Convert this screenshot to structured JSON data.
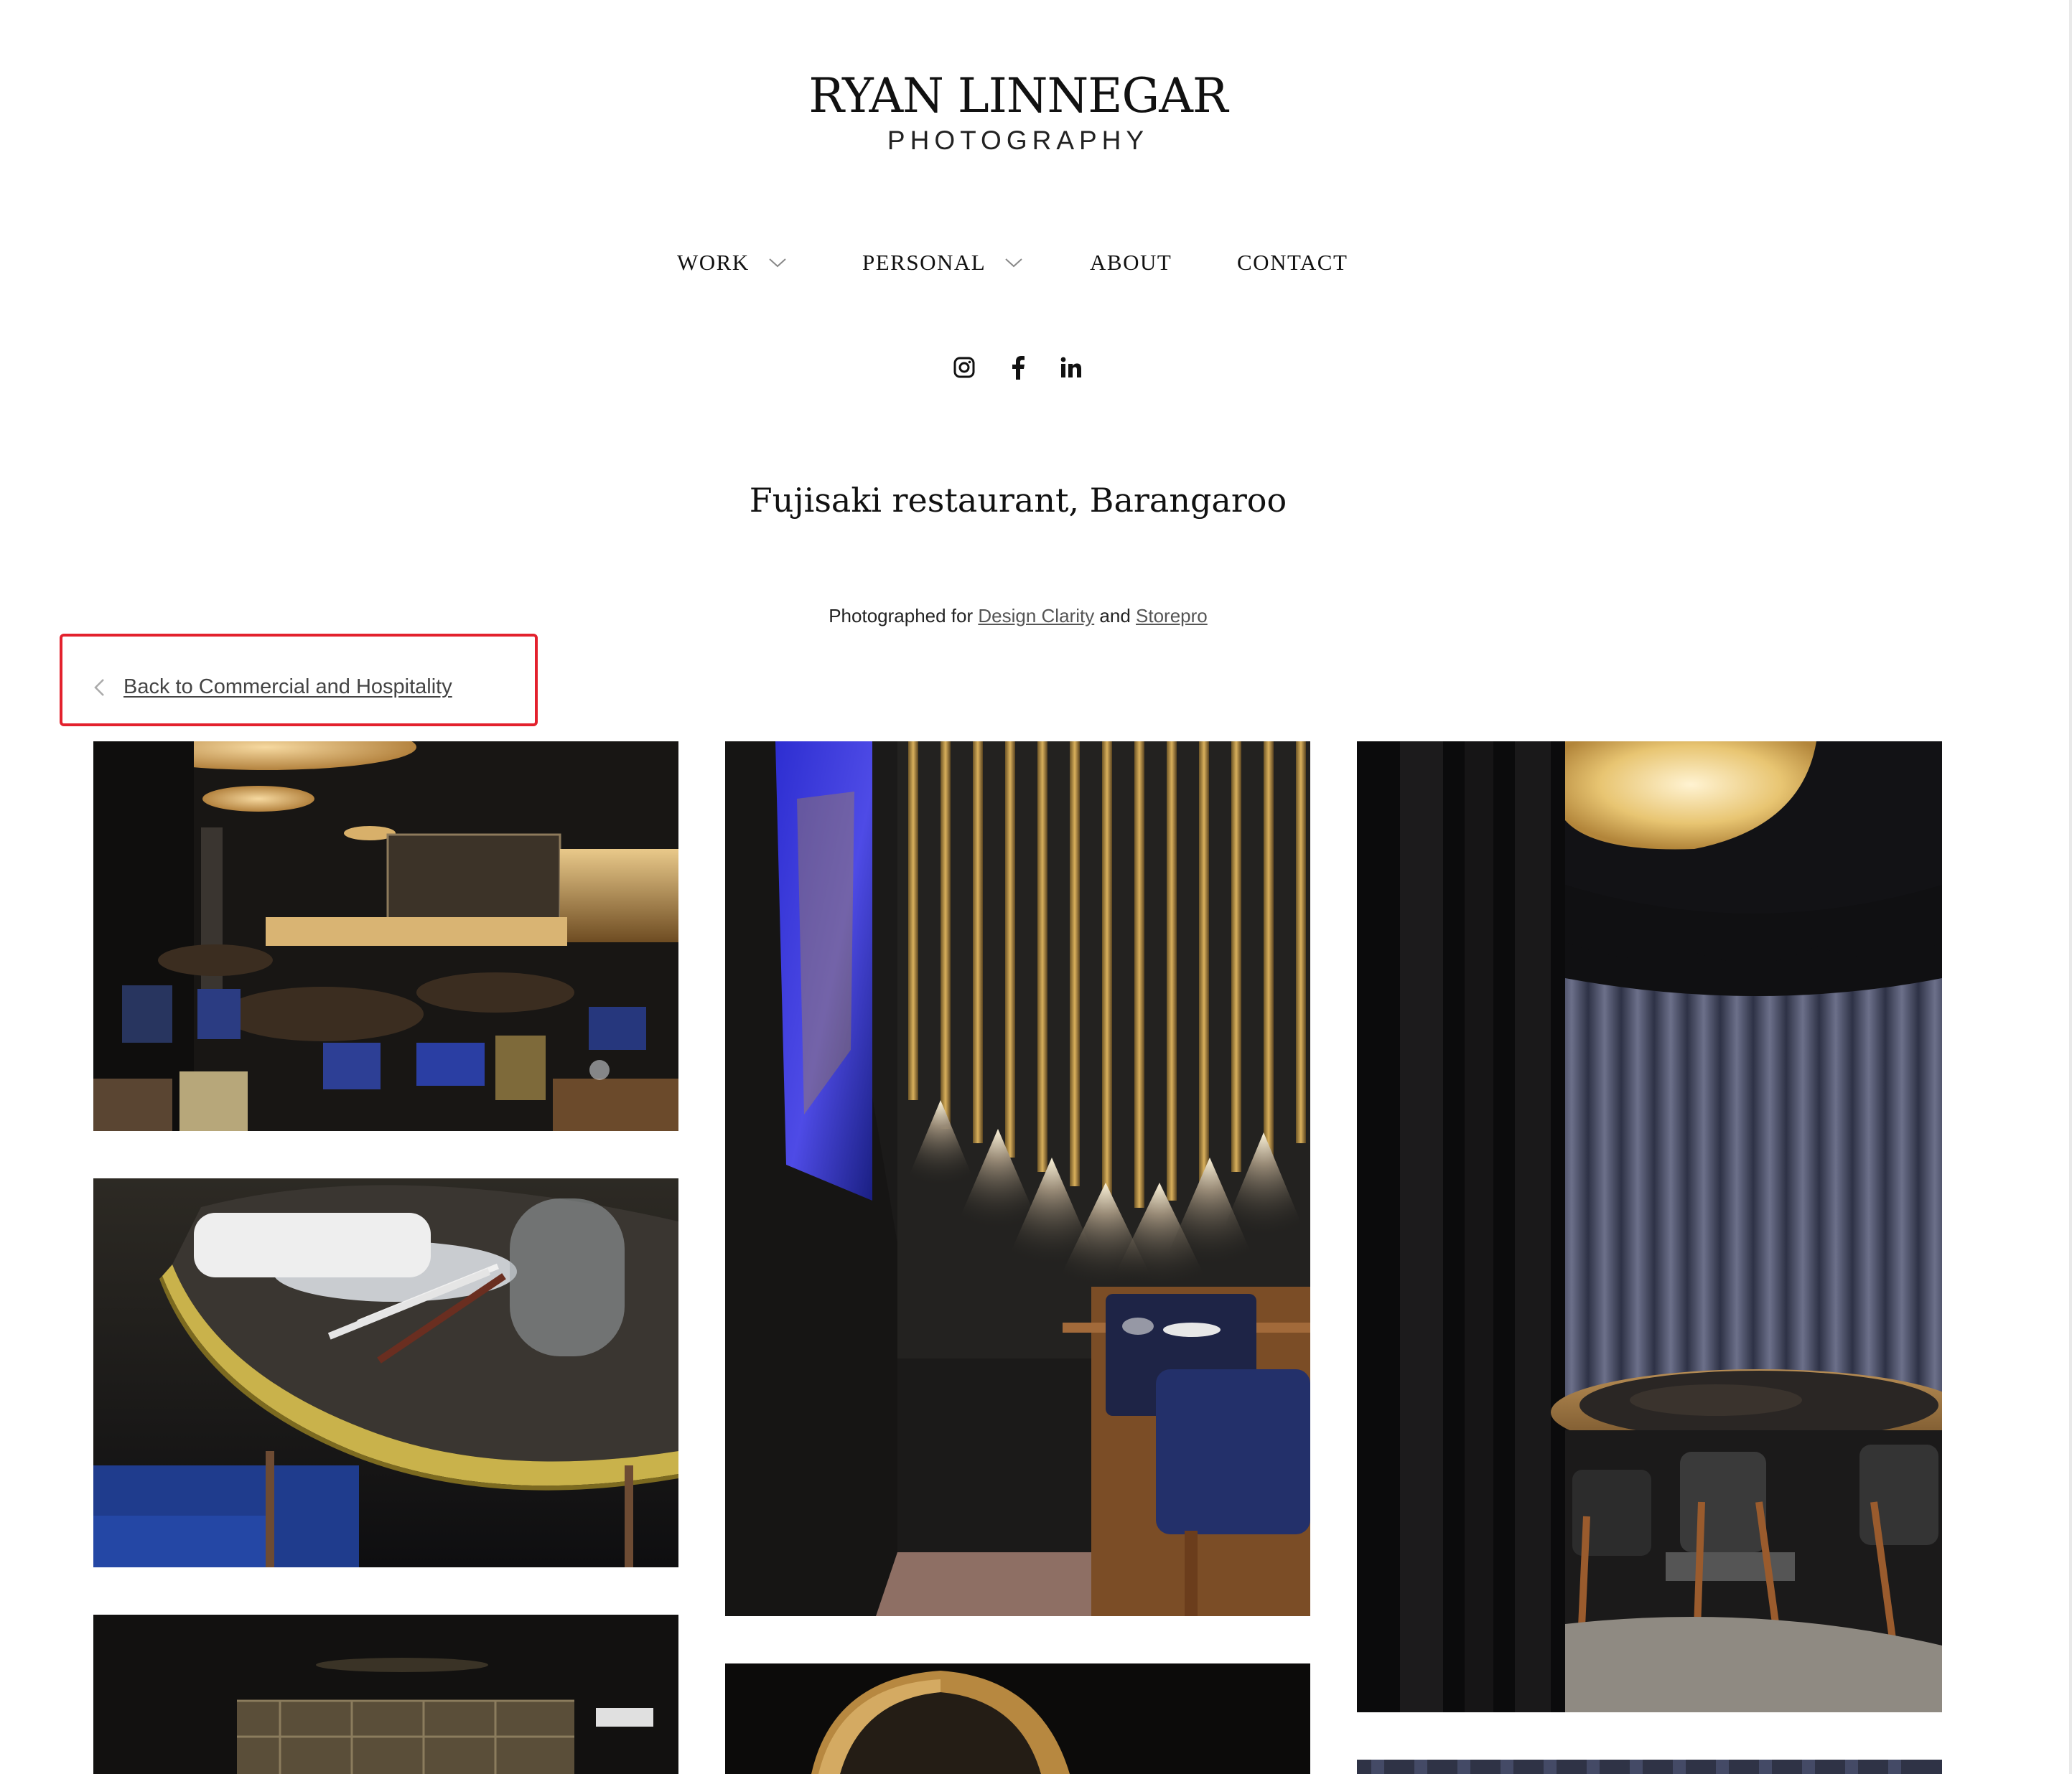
{
  "brand": {
    "name": "RYAN LINNEGAR",
    "subtitle": "PHOTOGRAPHY"
  },
  "nav": {
    "items": [
      {
        "label": "WORK",
        "has_dropdown": true
      },
      {
        "label": "PERSONAL",
        "has_dropdown": true
      },
      {
        "label": "ABOUT",
        "has_dropdown": false
      },
      {
        "label": "CONTACT",
        "has_dropdown": false
      }
    ]
  },
  "social": {
    "icons": [
      "instagram-icon",
      "facebook-icon",
      "linkedin-icon"
    ]
  },
  "page": {
    "title": "Fujisaki restaurant, Barangaroo",
    "caption_prefix": "Photographed for ",
    "caption_link1": "Design Clarity",
    "caption_and": " and ",
    "caption_link2": "Storepro"
  },
  "back_link": {
    "label": "Back to Commercial and Hospitality",
    "icon": "chevron-left-icon"
  },
  "colors": {
    "highlight": "#e3212d",
    "text": "#111111",
    "link": "#555555"
  }
}
